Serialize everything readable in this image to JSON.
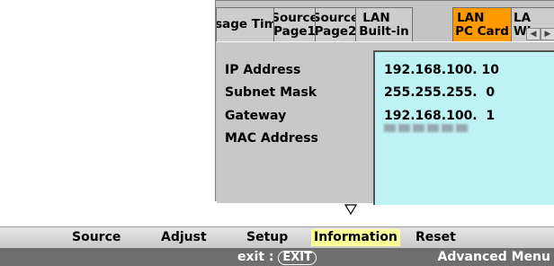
{
  "tabs": [
    {
      "line1": "Usage Time",
      "line2": ""
    },
    {
      "line1": "Source",
      "line2": "Page1"
    },
    {
      "line1": "Source",
      "line2": "Page2"
    },
    {
      "line1": "LAN",
      "line2": "Built-in"
    },
    {
      "line1": "LAN",
      "line2": "PC Card"
    },
    {
      "line1": "LA",
      "line2": "Wi"
    }
  ],
  "info": {
    "ip_label": "IP Address",
    "ip_value": "192.168.100. 10",
    "subnet_label": "Subnet Mask",
    "subnet_value": "255.255.255.  0",
    "gateway_label": "Gateway",
    "gateway_value": "192.168.100.  1",
    "mac_label": "MAC Address"
  },
  "menu": {
    "items": [
      "Source",
      "Adjust",
      "Setup",
      "Information",
      "Reset"
    ],
    "active": "Information"
  },
  "status": {
    "exit_prefix": "exit : ",
    "exit_key": "EXIT",
    "advanced_menu": "Advanced Menu"
  },
  "colors": {
    "active_tab": "#ff9900",
    "value_panel": "#bff2f5",
    "active_menu_item": "#ffff99",
    "status_bar": "#6e6e6e"
  }
}
